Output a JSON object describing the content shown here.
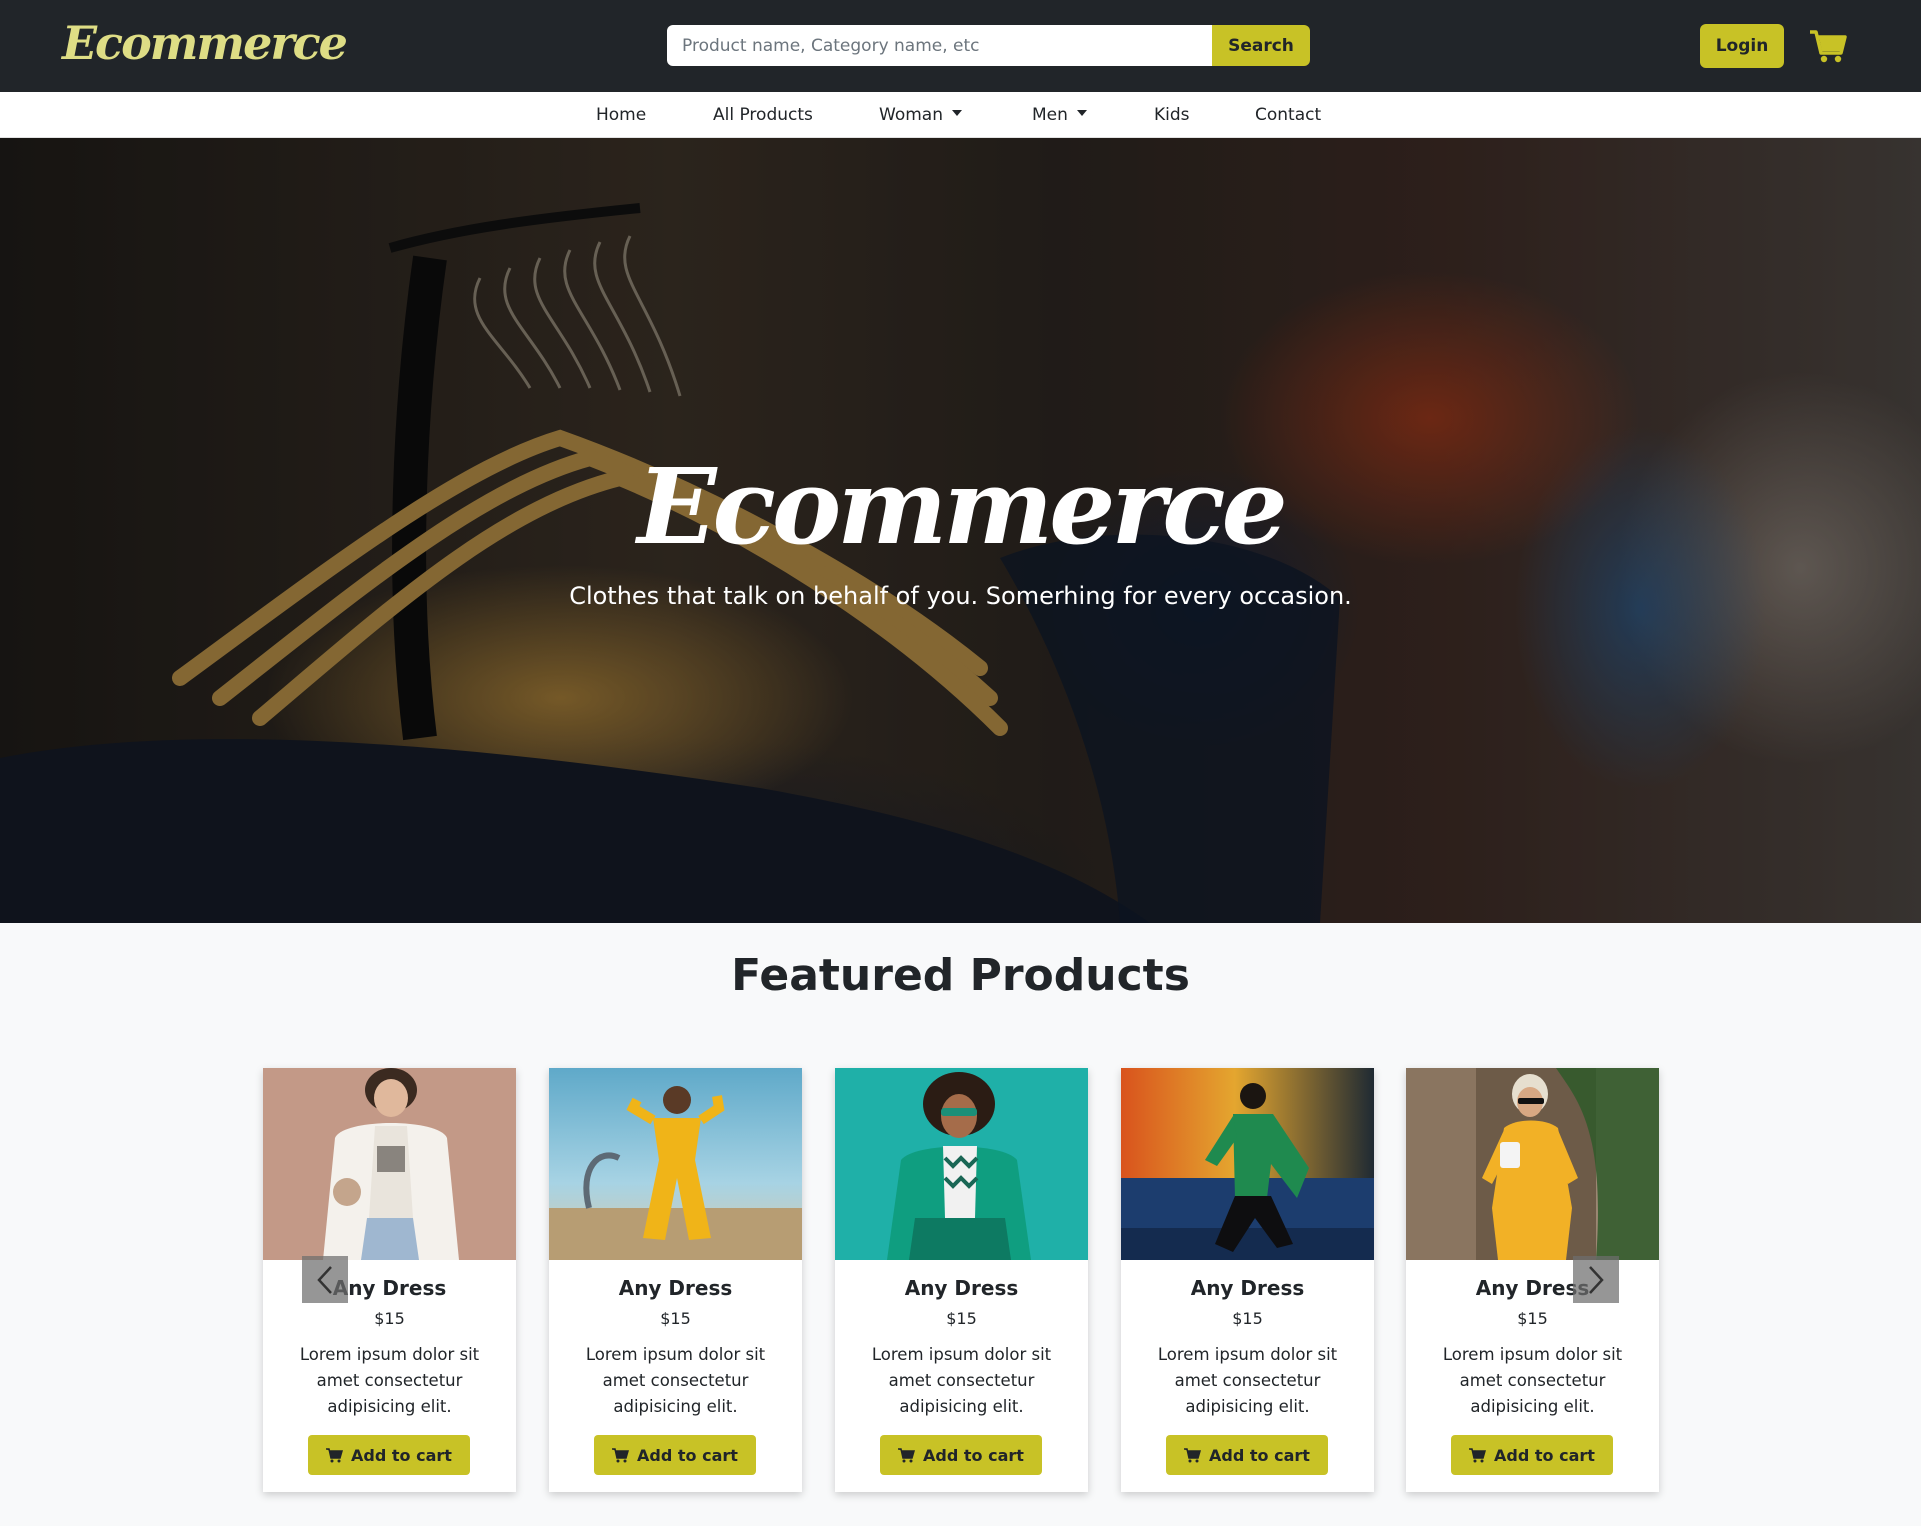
{
  "header": {
    "logo": "Ecommerce",
    "search_placeholder": "Product name, Category name, etc",
    "search_button": "Search",
    "login_button": "Login",
    "cart_icon": "cart-icon"
  },
  "nav": {
    "items": [
      {
        "label": "Home"
      },
      {
        "label": "All Products"
      },
      {
        "label": "Woman",
        "dropdown": true
      },
      {
        "label": "Men",
        "dropdown": true
      },
      {
        "label": "Kids"
      },
      {
        "label": "Contact"
      }
    ]
  },
  "hero": {
    "title": "Ecommerce",
    "subtitle": "Clothes that talk on behalf of you. Somerhing for every occasion."
  },
  "featured": {
    "title": "Featured Products",
    "products": [
      {
        "name": "Any Dress",
        "price": "$15",
        "description": "Lorem ipsum dolor sit amet consectetur adipisicing elit.",
        "button": "Add to cart"
      },
      {
        "name": "Any Dress",
        "price": "$15",
        "description": "Lorem ipsum dolor sit amet consectetur adipisicing elit.",
        "button": "Add to cart"
      },
      {
        "name": "Any Dress",
        "price": "$15",
        "description": "Lorem ipsum dolor sit amet consectetur adipisicing elit.",
        "button": "Add to cart"
      },
      {
        "name": "Any Dress",
        "price": "$15",
        "description": "Lorem ipsum dolor sit amet consectetur adipisicing elit.",
        "button": "Add to cart"
      },
      {
        "name": "Any Dress",
        "price": "$15",
        "description": "Lorem ipsum dolor sit amet consectetur adipisicing elit.",
        "button": "Add to cart"
      }
    ]
  },
  "carousel": {
    "prev_icon": "chevron-left-icon",
    "next_icon": "chevron-right-icon"
  },
  "colors": {
    "accent": "#c8c226",
    "header_bg": "#212529",
    "logo": "#dedd85"
  }
}
